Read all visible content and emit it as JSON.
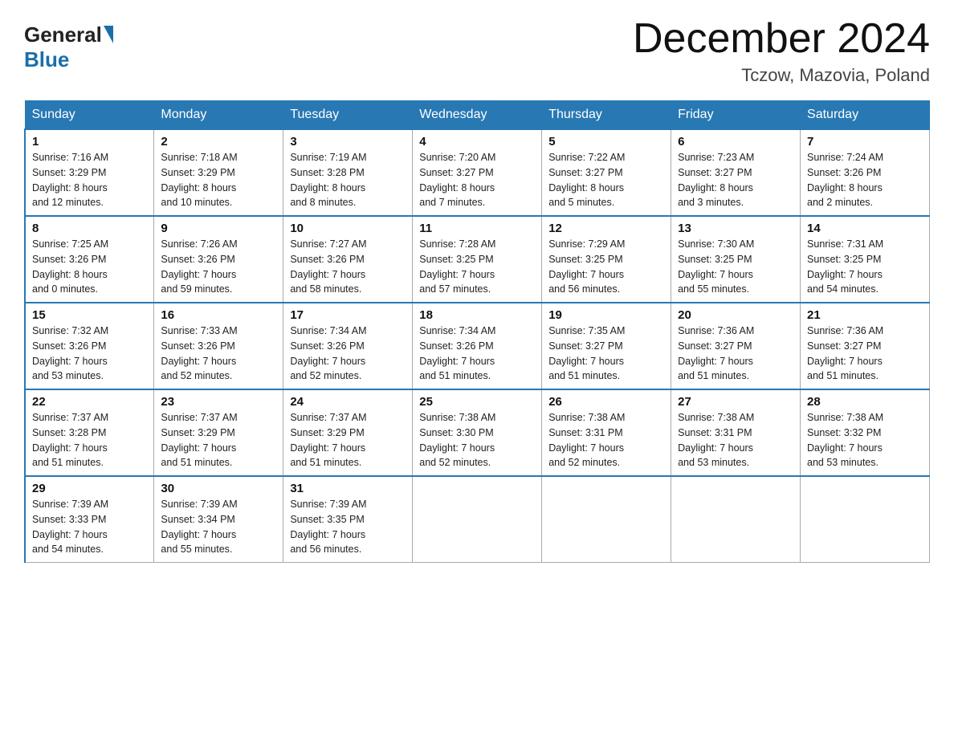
{
  "header": {
    "logo_general": "General",
    "logo_blue": "Blue",
    "month_title": "December 2024",
    "location": "Tczow, Mazovia, Poland"
  },
  "weekdays": [
    "Sunday",
    "Monday",
    "Tuesday",
    "Wednesday",
    "Thursday",
    "Friday",
    "Saturday"
  ],
  "weeks": [
    [
      {
        "day": "1",
        "sunrise": "7:16 AM",
        "sunset": "3:29 PM",
        "daylight": "8 hours and 12 minutes."
      },
      {
        "day": "2",
        "sunrise": "7:18 AM",
        "sunset": "3:29 PM",
        "daylight": "8 hours and 10 minutes."
      },
      {
        "day": "3",
        "sunrise": "7:19 AM",
        "sunset": "3:28 PM",
        "daylight": "8 hours and 8 minutes."
      },
      {
        "day": "4",
        "sunrise": "7:20 AM",
        "sunset": "3:27 PM",
        "daylight": "8 hours and 7 minutes."
      },
      {
        "day": "5",
        "sunrise": "7:22 AM",
        "sunset": "3:27 PM",
        "daylight": "8 hours and 5 minutes."
      },
      {
        "day": "6",
        "sunrise": "7:23 AM",
        "sunset": "3:27 PM",
        "daylight": "8 hours and 3 minutes."
      },
      {
        "day": "7",
        "sunrise": "7:24 AM",
        "sunset": "3:26 PM",
        "daylight": "8 hours and 2 minutes."
      }
    ],
    [
      {
        "day": "8",
        "sunrise": "7:25 AM",
        "sunset": "3:26 PM",
        "daylight": "8 hours and 0 minutes."
      },
      {
        "day": "9",
        "sunrise": "7:26 AM",
        "sunset": "3:26 PM",
        "daylight": "7 hours and 59 minutes."
      },
      {
        "day": "10",
        "sunrise": "7:27 AM",
        "sunset": "3:26 PM",
        "daylight": "7 hours and 58 minutes."
      },
      {
        "day": "11",
        "sunrise": "7:28 AM",
        "sunset": "3:25 PM",
        "daylight": "7 hours and 57 minutes."
      },
      {
        "day": "12",
        "sunrise": "7:29 AM",
        "sunset": "3:25 PM",
        "daylight": "7 hours and 56 minutes."
      },
      {
        "day": "13",
        "sunrise": "7:30 AM",
        "sunset": "3:25 PM",
        "daylight": "7 hours and 55 minutes."
      },
      {
        "day": "14",
        "sunrise": "7:31 AM",
        "sunset": "3:25 PM",
        "daylight": "7 hours and 54 minutes."
      }
    ],
    [
      {
        "day": "15",
        "sunrise": "7:32 AM",
        "sunset": "3:26 PM",
        "daylight": "7 hours and 53 minutes."
      },
      {
        "day": "16",
        "sunrise": "7:33 AM",
        "sunset": "3:26 PM",
        "daylight": "7 hours and 52 minutes."
      },
      {
        "day": "17",
        "sunrise": "7:34 AM",
        "sunset": "3:26 PM",
        "daylight": "7 hours and 52 minutes."
      },
      {
        "day": "18",
        "sunrise": "7:34 AM",
        "sunset": "3:26 PM",
        "daylight": "7 hours and 51 minutes."
      },
      {
        "day": "19",
        "sunrise": "7:35 AM",
        "sunset": "3:27 PM",
        "daylight": "7 hours and 51 minutes."
      },
      {
        "day": "20",
        "sunrise": "7:36 AM",
        "sunset": "3:27 PM",
        "daylight": "7 hours and 51 minutes."
      },
      {
        "day": "21",
        "sunrise": "7:36 AM",
        "sunset": "3:27 PM",
        "daylight": "7 hours and 51 minutes."
      }
    ],
    [
      {
        "day": "22",
        "sunrise": "7:37 AM",
        "sunset": "3:28 PM",
        "daylight": "7 hours and 51 minutes."
      },
      {
        "day": "23",
        "sunrise": "7:37 AM",
        "sunset": "3:29 PM",
        "daylight": "7 hours and 51 minutes."
      },
      {
        "day": "24",
        "sunrise": "7:37 AM",
        "sunset": "3:29 PM",
        "daylight": "7 hours and 51 minutes."
      },
      {
        "day": "25",
        "sunrise": "7:38 AM",
        "sunset": "3:30 PM",
        "daylight": "7 hours and 52 minutes."
      },
      {
        "day": "26",
        "sunrise": "7:38 AM",
        "sunset": "3:31 PM",
        "daylight": "7 hours and 52 minutes."
      },
      {
        "day": "27",
        "sunrise": "7:38 AM",
        "sunset": "3:31 PM",
        "daylight": "7 hours and 53 minutes."
      },
      {
        "day": "28",
        "sunrise": "7:38 AM",
        "sunset": "3:32 PM",
        "daylight": "7 hours and 53 minutes."
      }
    ],
    [
      {
        "day": "29",
        "sunrise": "7:39 AM",
        "sunset": "3:33 PM",
        "daylight": "7 hours and 54 minutes."
      },
      {
        "day": "30",
        "sunrise": "7:39 AM",
        "sunset": "3:34 PM",
        "daylight": "7 hours and 55 minutes."
      },
      {
        "day": "31",
        "sunrise": "7:39 AM",
        "sunset": "3:35 PM",
        "daylight": "7 hours and 56 minutes."
      },
      null,
      null,
      null,
      null
    ]
  ],
  "labels": {
    "sunrise": "Sunrise:",
    "sunset": "Sunset:",
    "daylight": "Daylight:"
  }
}
